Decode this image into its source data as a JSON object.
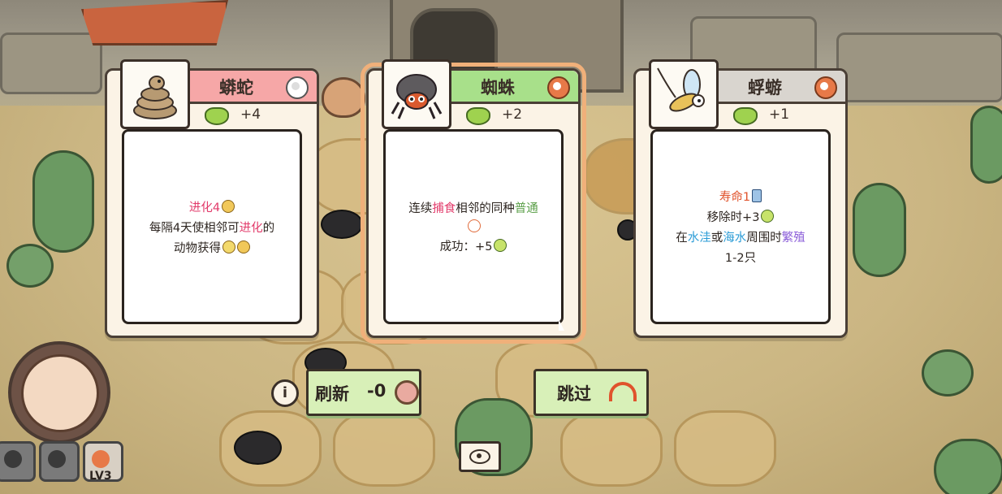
{
  "cards": [
    {
      "name": "蟒蛇",
      "badge_icon": "white-egg-icon",
      "reward": "+4",
      "lines": [
        [
          {
            "t": "进化4",
            "c": "red"
          },
          {
            "icon": "coin"
          }
        ],
        [
          {
            "t": "每隔4天使相邻可"
          },
          {
            "t": "进化",
            "c": "red"
          },
          {
            "t": "的"
          }
        ],
        [
          {
            "t": "动物获得"
          },
          {
            "icon": "evo"
          },
          {
            "icon": "coin"
          }
        ]
      ]
    },
    {
      "name": "蜘蛛",
      "badge_icon": "orange-egg-icon",
      "reward": "+2",
      "lines": [
        [
          {
            "t": "连续"
          },
          {
            "t": "捕食",
            "c": "red"
          },
          {
            "t": "相邻的同种"
          },
          {
            "t": "普通",
            "c": "green-t"
          }
        ],
        [
          {
            "icon": "eye"
          }
        ],
        [
          {
            "t": "成功：+5"
          },
          {
            "icon": "leaf"
          }
        ]
      ]
    },
    {
      "name": "蜉蝣",
      "badge_icon": "orange-egg-icon",
      "reward": "+1",
      "lines": [
        [
          {
            "t": "寿命1",
            "c": "orange-t"
          },
          {
            "icon": "sand"
          }
        ],
        [
          {
            "t": "移除时+3"
          },
          {
            "icon": "leaf"
          }
        ],
        [
          {
            "t": "在"
          },
          {
            "t": "水洼",
            "c": "blue"
          },
          {
            "t": "或"
          },
          {
            "t": "海水",
            "c": "blue"
          },
          {
            "t": "周围时"
          },
          {
            "t": "繁殖",
            "c": "purple"
          }
        ],
        [
          {
            "t": "1-2只"
          }
        ]
      ]
    }
  ],
  "buttons": {
    "refresh_label": "刷新",
    "refresh_cost": "-0",
    "skip_label": "跳过",
    "info_label": "i"
  },
  "hud": {
    "level": "LV3"
  }
}
